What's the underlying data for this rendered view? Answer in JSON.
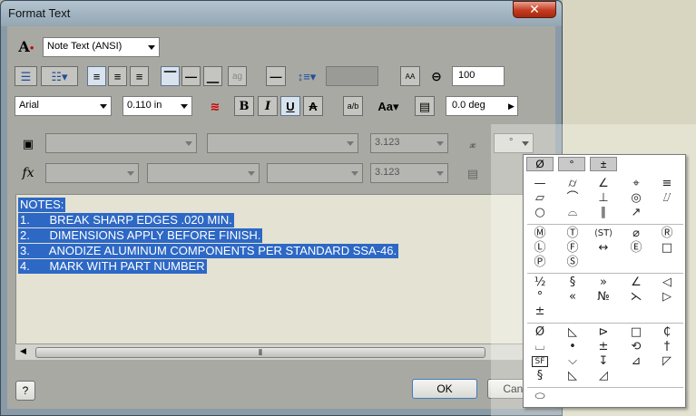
{
  "dialog": {
    "title": "Format Text",
    "close": "✕"
  },
  "row1": {
    "style": "Note Text (ANSI)"
  },
  "row2": {
    "stretch": "100"
  },
  "row3": {
    "font": "Arial",
    "size": "0.110 in",
    "bold": "B",
    "italic": "I",
    "underline": "U",
    "strike": "A",
    "rotation": "0.0 deg"
  },
  "row4": {
    "value": "3.123",
    "symbol_button": "°"
  },
  "row5": {
    "value": "3.123"
  },
  "editor": {
    "lines": [
      "NOTES:",
      "1.      BREAK SHARP EDGES .020 MIN.",
      "2.      DIMENSIONS APPLY BEFORE FINISH.",
      "3.      ANODIZE ALUMINUM COMPONENTS PER STANDARD SSA-46.",
      "4.      MARK WITH PART NUMBER"
    ]
  },
  "buttons": {
    "ok": "OK",
    "cancel": "Cancel",
    "help": "?"
  },
  "symbols": {
    "tabs": [
      "Ø",
      "°",
      "±"
    ],
    "ellipsis": "..."
  },
  "colors": {
    "selection": "#2d68c5",
    "dialog_frame": "#8a9aa7"
  }
}
